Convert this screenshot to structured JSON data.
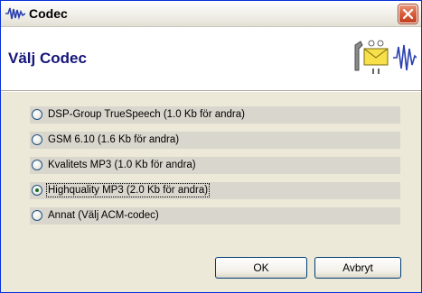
{
  "window": {
    "title": "Codec"
  },
  "header": {
    "title": "Välj Codec"
  },
  "codec_options": [
    {
      "label": "DSP-Group TrueSpeech (1.0 Kb för andra)",
      "selected": false
    },
    {
      "label": "GSM 6.10 (1.6 Kb för andra)",
      "selected": false
    },
    {
      "label": "Kvalitets MP3 (1.0 Kb för andra)",
      "selected": false
    },
    {
      "label": "Highquality MP3 (2.0 Kb för andra)",
      "selected": true
    },
    {
      "label": "Annat (Välj ACM-codec)",
      "selected": false
    }
  ],
  "buttons": {
    "ok": "OK",
    "cancel": "Avbryt"
  },
  "colors": {
    "header_title": "#15157a",
    "window_border": "#0831d9",
    "close_button": "#d95c3a",
    "radio_checked_dot": "#1f6b1f",
    "option_row_bg": "#d9d6cd"
  },
  "icons": {
    "app": "waveform-icon",
    "header_logo": "tools-envelope-waveform-icon",
    "close": "close-icon"
  }
}
